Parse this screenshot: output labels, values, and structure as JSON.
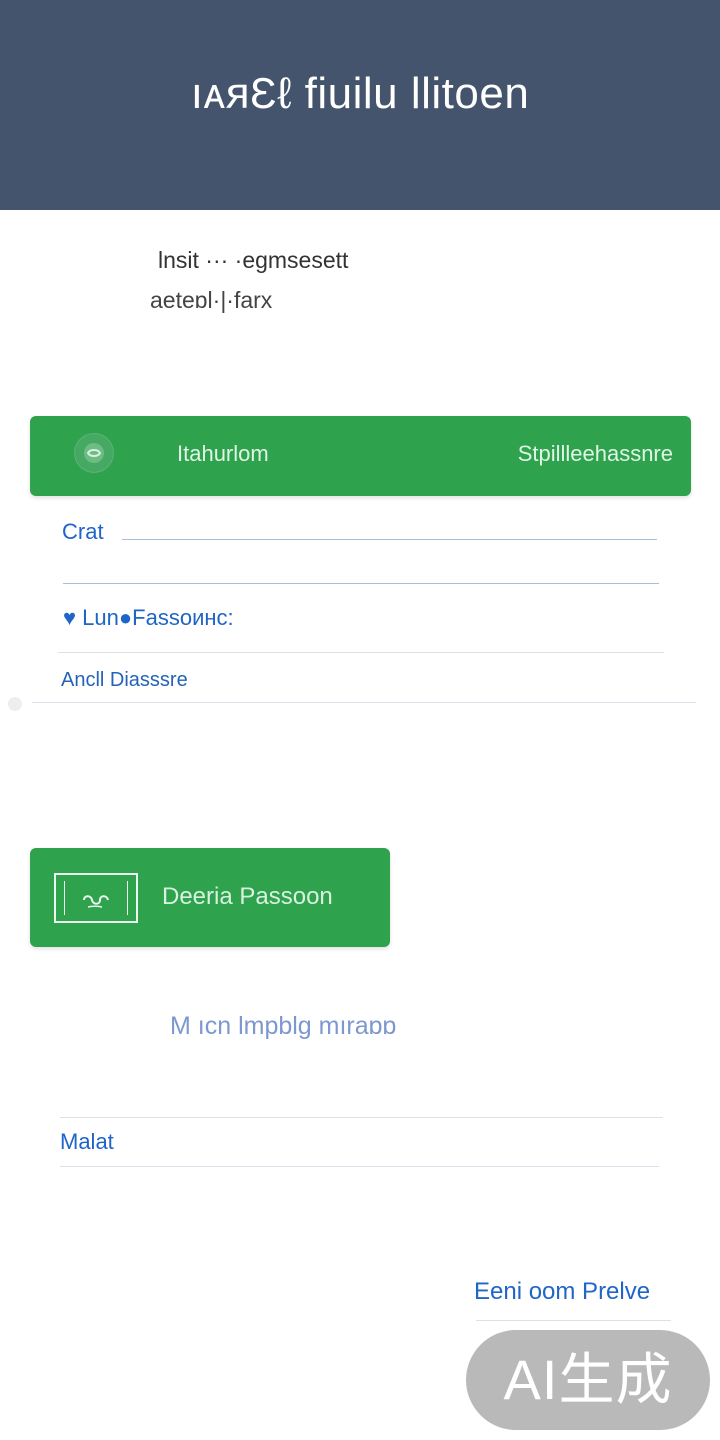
{
  "header": {
    "title": "ıᴀᴙƐℓ fiuilu llitoen"
  },
  "intro": {
    "line_one": "lnsit ··· ·egmsesett",
    "line_two": "aetеɒl·|·farx"
  },
  "primary_bar": {
    "left_label": "Itahurlom",
    "right_label": "Stpillleehassnre",
    "icon": "circle-icon"
  },
  "form": {
    "field_one_label": "Crat",
    "field_two_label": "♥ Lun●Fassoинc:",
    "field_three_label": "Ancll Diasssre"
  },
  "secondary_button": {
    "label": "Deeria Passoon",
    "icon": "password-key-icon"
  },
  "message": {
    "text": "M ıcn lmpblg mıraɒɒ"
  },
  "bottom_field": {
    "label": "Malat"
  },
  "footer_link": {
    "text": "Eeni oom Prelve"
  },
  "badge": {
    "text": "AI生成"
  },
  "colors": {
    "header": "#45546d",
    "green": "#2ea24d",
    "blue": "#1f65c8",
    "badge": "#b9b9b9"
  }
}
